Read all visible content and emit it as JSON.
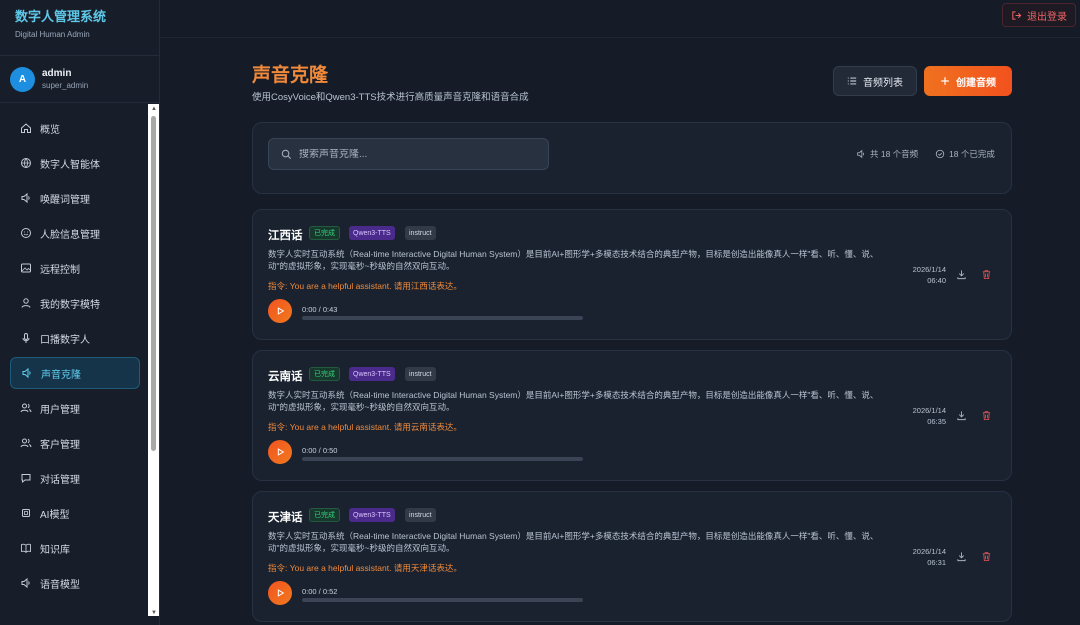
{
  "brand": {
    "title": "数字人管理系统",
    "subtitle": "Digital Human Admin"
  },
  "user": {
    "avatar": "A",
    "name": "admin",
    "role": "super_admin"
  },
  "nav": [
    {
      "label": "概览",
      "icon": "home-icon"
    },
    {
      "label": "数字人智能体",
      "icon": "globe-icon"
    },
    {
      "label": "唤醒词管理",
      "icon": "speaker-icon"
    },
    {
      "label": "人脸信息管理",
      "icon": "smile-icon"
    },
    {
      "label": "远程控制",
      "icon": "image-icon"
    },
    {
      "label": "我的数字模特",
      "icon": "person-icon"
    },
    {
      "label": "口播数字人",
      "icon": "mic-icon"
    },
    {
      "label": "声音克隆",
      "icon": "speaker-icon",
      "active": true
    },
    {
      "label": "用户管理",
      "icon": "users-icon"
    },
    {
      "label": "客户管理",
      "icon": "users-icon"
    },
    {
      "label": "对话管理",
      "icon": "chat-icon"
    },
    {
      "label": "AI模型",
      "icon": "cpu-icon"
    },
    {
      "label": "知识库",
      "icon": "book-icon"
    },
    {
      "label": "语音模型",
      "icon": "speaker-icon"
    }
  ],
  "topbar": {
    "logout": "退出登录"
  },
  "header": {
    "title": "声音克隆",
    "description": "使用CosyVoice和Qwen3-TTS技术进行高质量声音克隆和语音合成",
    "list_button": "音频列表",
    "create_button": "创建音频"
  },
  "search": {
    "placeholder": "搜索声音克隆..."
  },
  "stats": {
    "total": "共 18 个音频",
    "done": "18 个已完成"
  },
  "cards": [
    {
      "title": "江西话",
      "status": "已完成",
      "model": "Qwen3-TTS",
      "mode": "instruct",
      "text": "数字人实时互动系统（Real-time Interactive Digital Human System）是目前AI+图形学+多模态技术结合的典型产物，目标是创造出能像真人一样\"看、听、懂、说、动\"的虚拟形象，实现毫秒~秒级的自然双向互动。",
      "instruction": "指令: You are a helpful assistant. 请用江西话表达。",
      "time": "0:00  /  0:43",
      "date": "2026/1/14",
      "clock": "06:40"
    },
    {
      "title": "云南话",
      "status": "已完成",
      "model": "Qwen3-TTS",
      "mode": "instruct",
      "text": "数字人实时互动系统（Real-time Interactive Digital Human System）是目前AI+图形学+多模态技术结合的典型产物，目标是创造出能像真人一样\"看、听、懂、说、动\"的虚拟形象，实现毫秒~秒级的自然双向互动。",
      "instruction": "指令: You are a helpful assistant. 请用云南话表达。",
      "time": "0:00  /  0:50",
      "date": "2026/1/14",
      "clock": "06:35"
    },
    {
      "title": "天津话",
      "status": "已完成",
      "model": "Qwen3-TTS",
      "mode": "instruct",
      "text": "数字人实时互动系统（Real-time Interactive Digital Human System）是目前AI+图形学+多模态技术结合的典型产物，目标是创造出能像真人一样\"看、听、懂、说、动\"的虚拟形象，实现毫秒~秒级的自然双向互动。",
      "instruction": "指令: You are a helpful assistant. 请用天津话表达。",
      "time": "0:00  /  0:52",
      "date": "2026/1/14",
      "clock": "06:31"
    }
  ]
}
